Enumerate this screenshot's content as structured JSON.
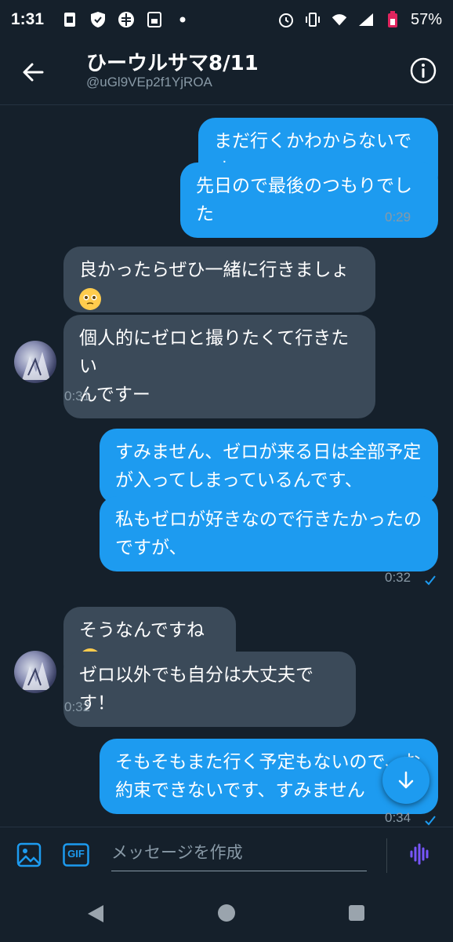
{
  "status_bar": {
    "time": "1:31",
    "battery": "57%",
    "left_icons": [
      "sim-icon",
      "shield-icon",
      "app-icon",
      "save-icon",
      "dot-icon"
    ],
    "right_icons": [
      "alarm-icon",
      "vibrate-icon",
      "wifi-icon",
      "signal-icon",
      "battery-icon"
    ]
  },
  "header": {
    "title": "ひーウルサマ8/11",
    "handle": "@uGl9VEp2f1YjROA"
  },
  "messages": [
    {
      "dir": "out",
      "text": "まだ行くかわからないです"
    },
    {
      "dir": "out",
      "text": "先日ので最後のつもりでした",
      "time": "0:29"
    },
    {
      "dir": "in",
      "text": "良かったらぜひ一緒に行きましょ",
      "emoji": "pleading-face-emoji"
    },
    {
      "dir": "in",
      "text_line1": "個人的にゼロと撮りたくて行きたい",
      "text_line2": "んですー",
      "time": "0:31"
    },
    {
      "dir": "out",
      "text_line1": "すみません、ゼロが来る日は全部予定",
      "text_line2": "が入ってしまっているんです、"
    },
    {
      "dir": "out",
      "text_line1": "私もゼロが好きなので行きたかったの",
      "text_line2": "ですが、",
      "time": "0:32"
    },
    {
      "dir": "in",
      "text": "そうなんですね",
      "emoji": "sad-sweat-emoji"
    },
    {
      "dir": "in",
      "text": "ゼロ以外でも自分は大丈夫です！",
      "time": "0:32"
    },
    {
      "dir": "out",
      "text_line1": "そもそもまた行く予定もないので、お",
      "text_line2": "約束できないです、すみません",
      "time": "0:34"
    }
  ],
  "composer": {
    "placeholder": "メッセージを作成",
    "gif_label": "GIF"
  },
  "colors": {
    "background": "#15202b",
    "outgoing_bubble": "#1d9bf0",
    "incoming_bubble": "#3b4a59",
    "muted_text": "#8899a6",
    "voice_accent": "#7856ff"
  }
}
